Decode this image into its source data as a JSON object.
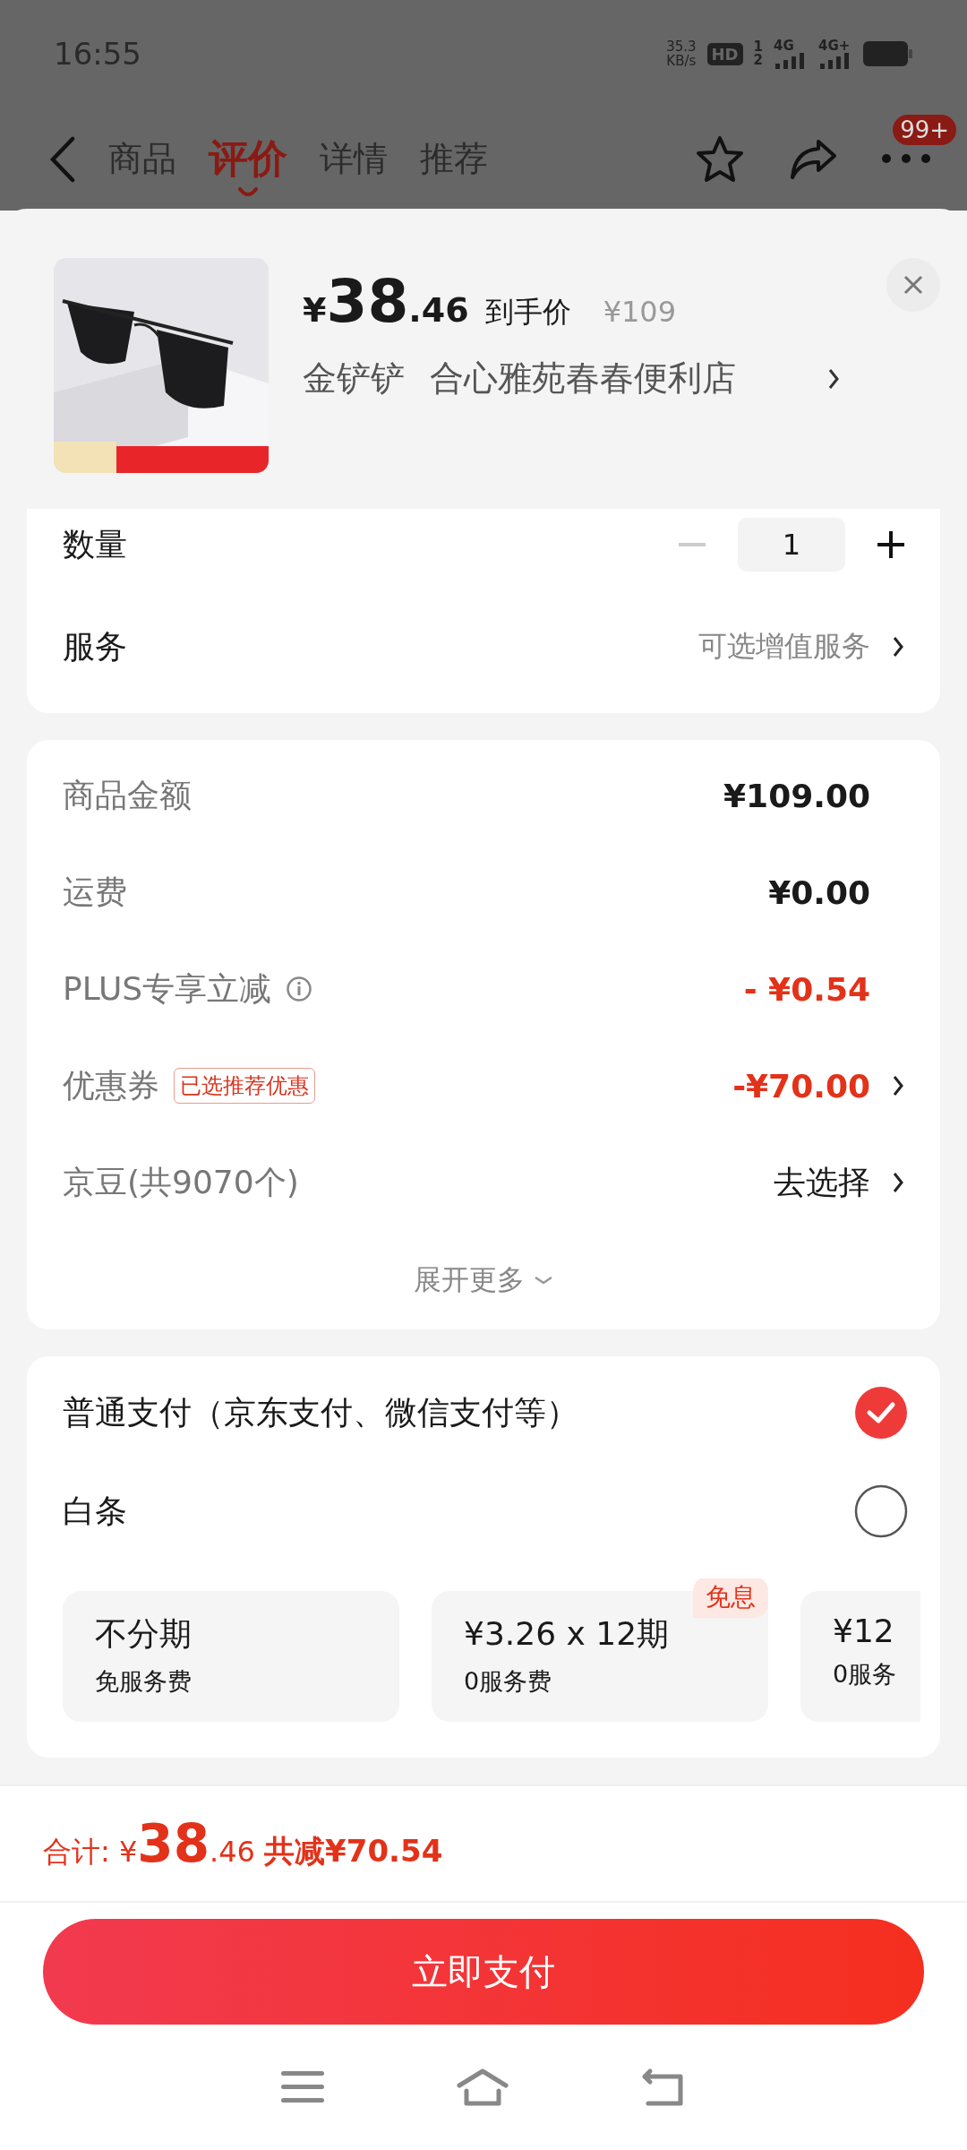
{
  "status_bar": {
    "time": "16:55",
    "speed": "35.3",
    "speed_unit": "KB/s",
    "hd": "HD",
    "sims": [
      "1",
      "2"
    ],
    "networks": [
      "4G",
      "4G+"
    ]
  },
  "nav": {
    "tabs": [
      {
        "label": "商品",
        "selected": false
      },
      {
        "label": "评价",
        "selected": true
      },
      {
        "label": "详情",
        "selected": false
      },
      {
        "label": "推荐",
        "selected": false
      }
    ],
    "badge": "99+"
  },
  "product": {
    "currency": "¥",
    "price_int": "38",
    "price_dec": ".46",
    "price_label": "到手价",
    "original_price": "¥109",
    "spec": "金铲铲",
    "store": "合心雅苑春春便利店"
  },
  "quantity": {
    "label": "数量",
    "value": "1",
    "minus_disabled": true
  },
  "service": {
    "label": "服务",
    "hint": "可选增值服务"
  },
  "fees": [
    {
      "label": "商品金额",
      "value": "¥109.00",
      "kind": "normal",
      "info": false,
      "arrow": false
    },
    {
      "label": "运费",
      "value": "¥0.00",
      "kind": "normal",
      "info": false,
      "arrow": false
    },
    {
      "label": "PLUS专享立减",
      "value": "- ¥0.54",
      "kind": "discount",
      "info": true,
      "arrow": false
    },
    {
      "label": "优惠券",
      "tag": "已选推荐优惠",
      "value": "-¥70.00",
      "kind": "discount",
      "info": false,
      "arrow": true
    },
    {
      "label": "京豆(共9070个)",
      "value": "去选择",
      "kind": "link",
      "info": false,
      "arrow": true
    }
  ],
  "expand": "展开更多",
  "payments": [
    {
      "label": "普通支付（京东支付、微信支付等）",
      "selected": true
    },
    {
      "label": "白条",
      "selected": false
    }
  ],
  "plans": [
    {
      "title": "不分期",
      "sub": "免服务费"
    },
    {
      "title": "¥3.26 x 12期",
      "sub": "0服务费",
      "badge": "免息"
    },
    {
      "title": "¥12",
      "sub": "0服务"
    }
  ],
  "total": {
    "label": "合计:",
    "currency": "¥",
    "int": "38",
    "dec": ".46",
    "saving": "共减¥70.54"
  },
  "pay_button": "立即支付"
}
